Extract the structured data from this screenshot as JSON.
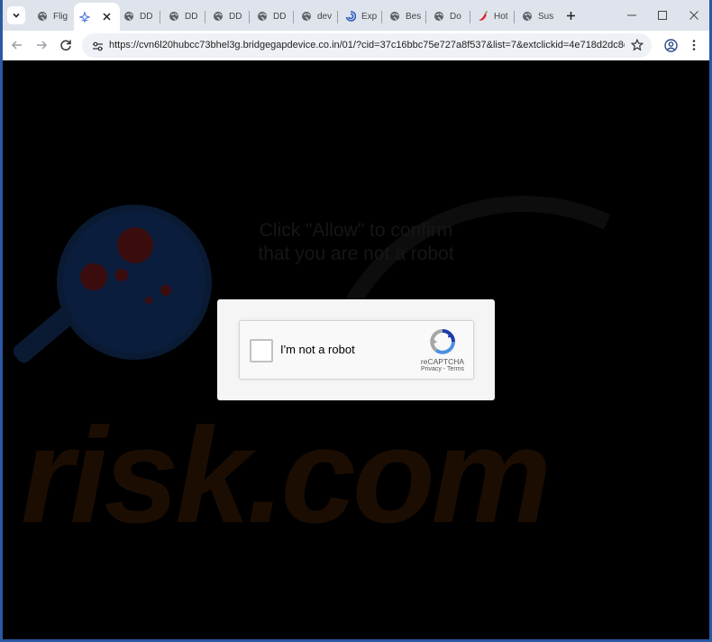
{
  "tabs": [
    {
      "label": "Flig",
      "favicon": "globe-icon",
      "active": false
    },
    {
      "label": "",
      "favicon": "sparkle-icon",
      "active": true
    },
    {
      "label": "DD",
      "favicon": "globe-icon",
      "active": false
    },
    {
      "label": "DD",
      "favicon": "globe-icon",
      "active": false
    },
    {
      "label": "DD",
      "favicon": "globe-icon",
      "active": false
    },
    {
      "label": "DD",
      "favicon": "globe-icon",
      "active": false
    },
    {
      "label": "dev",
      "favicon": "globe-icon",
      "active": false
    },
    {
      "label": "Exp",
      "favicon": "swirl-icon",
      "active": false
    },
    {
      "label": "Bes",
      "favicon": "globe-icon",
      "active": false
    },
    {
      "label": "Do",
      "favicon": "globe-icon",
      "active": false
    },
    {
      "label": "Hot",
      "favicon": "pepper-icon",
      "active": false
    },
    {
      "label": "Sus",
      "favicon": "globe-icon",
      "active": false
    }
  ],
  "toolbar": {
    "url": "https://cvn6l20hubcc73bhel3g.bridgegapdevice.co.in/01/?cid=37c16bbc75e727a8f537&list=7&extclickid=4e718d2dc8ce..."
  },
  "page": {
    "headline_line1": "Click \"Allow\" to confirm",
    "headline_line2": "that you are not a robot",
    "watermark": "risk.com"
  },
  "captcha": {
    "label": "I'm not a robot",
    "brand": "reCAPTCHA",
    "privacy": "Privacy",
    "separator": " - ",
    "terms": "Terms"
  },
  "colors": {
    "window_border": "#2b58a3",
    "tabstrip": "#dfe3eb",
    "page_background": "#000000",
    "recaptcha_blue": "#1c3aa9",
    "recaptcha_grey": "#a6a6a6"
  }
}
